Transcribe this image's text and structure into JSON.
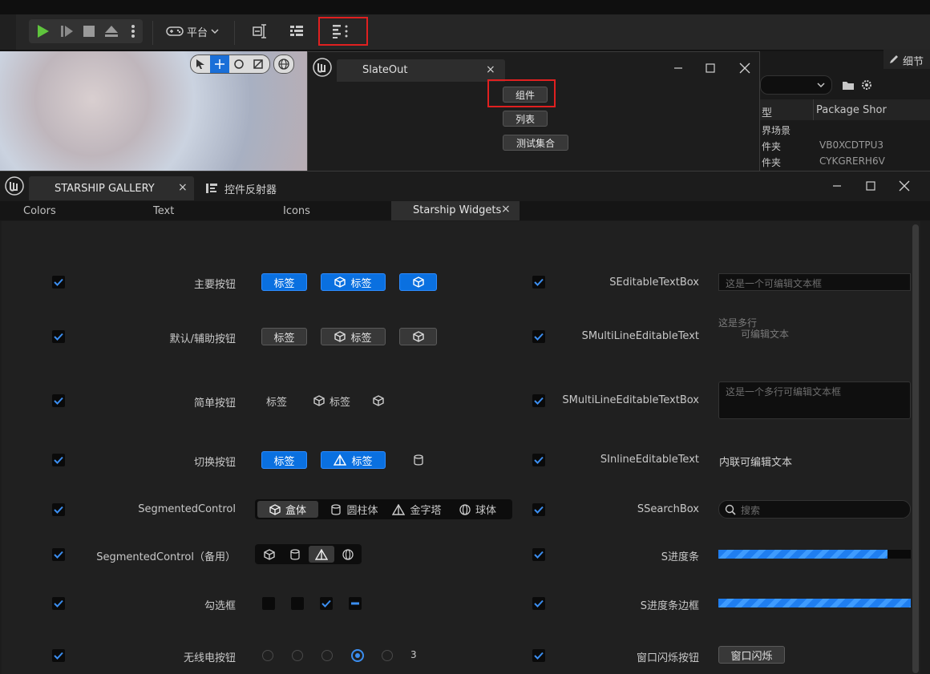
{
  "toolbar": {
    "platform_label": "平台"
  },
  "slateout": {
    "tab_title": "SlateOut",
    "buttons": [
      "组件",
      "列表",
      "测试集合"
    ]
  },
  "right_panel": {
    "details_label": "细节",
    "col_type": "型",
    "col_package": "Package Shor",
    "rows": [
      {
        "type": "界场景",
        "pkg": ""
      },
      {
        "type": "件夹",
        "pkg": "VB0XCDTPU3"
      },
      {
        "type": "件夹",
        "pkg": "CYKGRERH6V"
      }
    ]
  },
  "gallery": {
    "tab_title": "STARSHIP GALLERY",
    "tab2_title": "控件反射器",
    "subtabs": [
      "Colors",
      "Text",
      "Icons",
      "Starship Widgets"
    ],
    "left_rows": {
      "r1": "主要按钮",
      "r2": "默认/辅助按钮",
      "r3": "简单按钮",
      "r4": "切换按钮",
      "r5": "SegmentedControl",
      "r6": "SegmentedControl（备用）",
      "r7": "勾选框",
      "r8": "无线电按钮"
    },
    "btn_label": "标签",
    "segmented": [
      "盒体",
      "圆柱体",
      "金字塔",
      "球体"
    ],
    "radio_count": "3",
    "right_rows": {
      "r1": "SEditableTextBox",
      "r2": "SMultiLineEditableText",
      "r3": "SMultiLineEditableTextBox",
      "r4": "SInlineEditableText",
      "r5": "SSearchBox",
      "r6": "S进度条",
      "r7": "S进度条边框",
      "r8": "窗口闪烁按钮"
    },
    "editable_placeholder": "这是一个可编辑文本框",
    "multiline_line1": "这是多行",
    "multiline_line2": "可编辑文本",
    "multiline_box_placeholder": "这是一个多行可编辑文本框",
    "inline_text": "内联可编辑文本",
    "search_placeholder": "搜索",
    "progress_fraction": 0.88,
    "progress_border_fraction": 1.0,
    "flash_button": "窗口闪烁"
  },
  "colors": {
    "accent": "#0a70e0",
    "highlight_box": "#e02020",
    "play_green": "#5fc43d"
  }
}
